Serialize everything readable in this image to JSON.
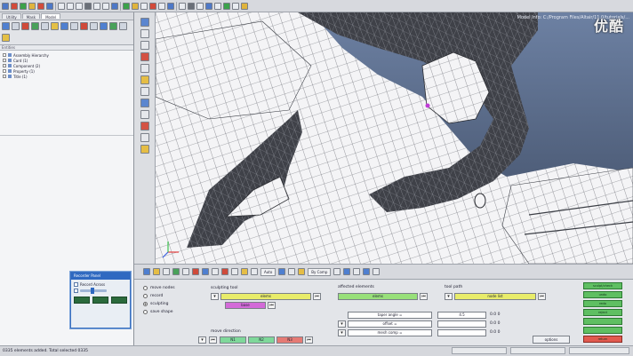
{
  "left_tabs": [
    "Utility",
    "Mask",
    "Model"
  ],
  "entities_header": "Entities",
  "tree_items": [
    "Assembly Hierarchy",
    "Card (1)",
    "Component (2)",
    "Property (1)",
    "Title (1)"
  ],
  "viewport": {
    "model_info": "Model Info: C:/Program Files/Altair/11.0/tutorials/...",
    "logo": "优酷"
  },
  "recorder": {
    "title": "Recorder Panel",
    "record_label": "Record Across"
  },
  "toolbar": {
    "auto_label": "Auto",
    "by_comp_label": "By Comp"
  },
  "panel": {
    "modes": [
      "move nodes",
      "record",
      "sculpting",
      "save shape"
    ],
    "selected_mode": 2,
    "sculpting_tool_label": "sculpting tool",
    "sculpt_elems": "elems",
    "sculpt_base": "base",
    "affected_elements_label": "affected elements",
    "affected_elems": "elems",
    "tool_path_label": "tool path",
    "tool_path_value": "node list",
    "taper_angle_label": "taper angle =",
    "taper_angle_value": "4.5",
    "taper_angle_extra": "0.0 0",
    "offset_label": "offset =",
    "offset_extra": "0.0 0",
    "mesh_comp_label": "mesh comp =",
    "mesh_comp_extra": "0.0 0",
    "move_direction_label": "move direction",
    "dir_n1": "N1",
    "dir_n2": "N2",
    "dir_n3": "N3",
    "options_label": "options",
    "side_buttons": [
      "sculpt/check",
      "undo",
      "redo",
      "reject",
      "return"
    ]
  },
  "status": {
    "text": "0335 elements added. Total selected 0335"
  }
}
